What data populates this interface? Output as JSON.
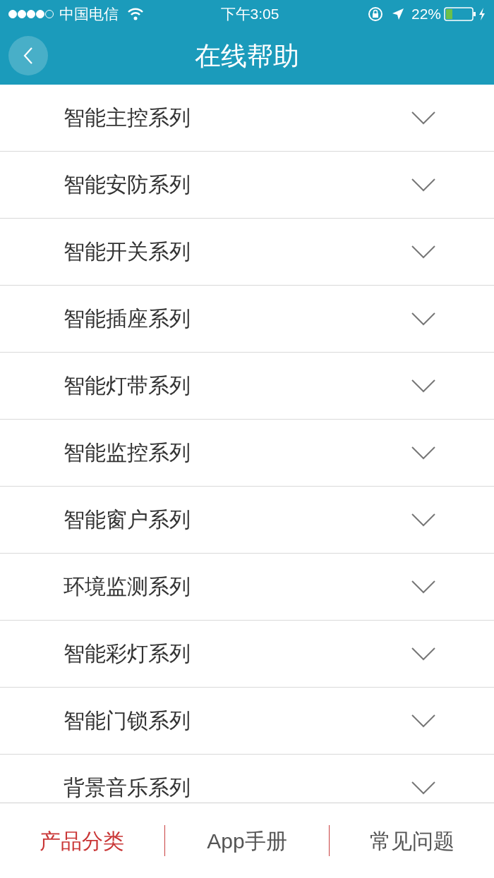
{
  "status_bar": {
    "carrier": "中国电信",
    "time": "下午3:05",
    "battery": "22%"
  },
  "header": {
    "title": "在线帮助"
  },
  "categories": [
    {
      "label": "智能主控系列",
      "expanded": false
    },
    {
      "label": "智能安防系列",
      "expanded": false
    },
    {
      "label": "智能开关系列",
      "expanded": false
    },
    {
      "label": "智能插座系列",
      "expanded": false
    },
    {
      "label": "智能灯带系列",
      "expanded": false
    },
    {
      "label": "智能监控系列",
      "expanded": false
    },
    {
      "label": "智能窗户系列",
      "expanded": false
    },
    {
      "label": "环境监测系列",
      "expanded": false
    },
    {
      "label": "智能彩灯系列",
      "expanded": false
    },
    {
      "label": "智能门锁系列",
      "expanded": false
    },
    {
      "label": "背景音乐系列",
      "expanded": false
    }
  ],
  "tabs": [
    {
      "label": "产品分类",
      "selected": true
    },
    {
      "label": "App手册",
      "selected": false
    },
    {
      "label": "常见问题",
      "selected": false
    }
  ]
}
